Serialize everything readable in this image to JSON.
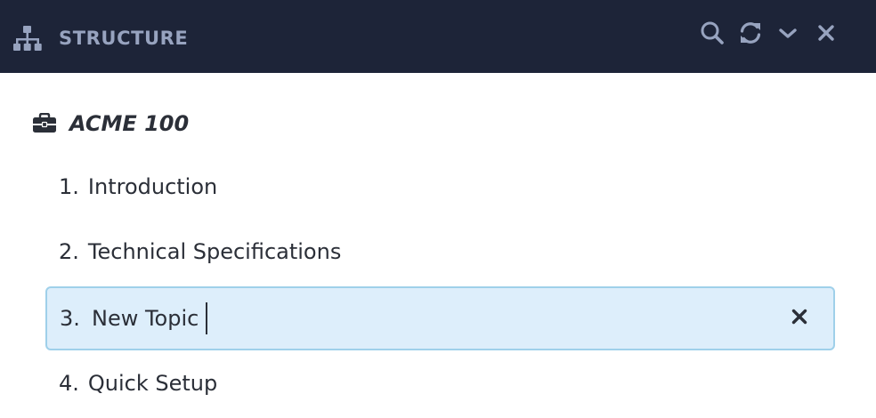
{
  "header": {
    "title": "STRUCTURE",
    "icons": {
      "structure": "sitemap-icon",
      "search": "search-icon",
      "refresh": "refresh-icon",
      "collapse": "chevron-down-icon",
      "close": "close-icon"
    },
    "colors": {
      "background": "#1d2438",
      "title": "#97a3bf",
      "icons": "#97a3bf"
    }
  },
  "tree": {
    "root": {
      "label": "ACME 100",
      "icon": "briefcase-icon"
    },
    "topics": [
      {
        "number": "1.",
        "label": "Introduction"
      },
      {
        "number": "2.",
        "label": "Technical Specifications"
      },
      {
        "number": "3.",
        "label": "New Topic",
        "editing": true
      },
      {
        "number": "4.",
        "label": "Quick Setup"
      }
    ],
    "edit": {
      "clear_icon": "close-icon",
      "colors": {
        "background": "#ddeefb",
        "border": "#9fd0ea"
      }
    }
  }
}
